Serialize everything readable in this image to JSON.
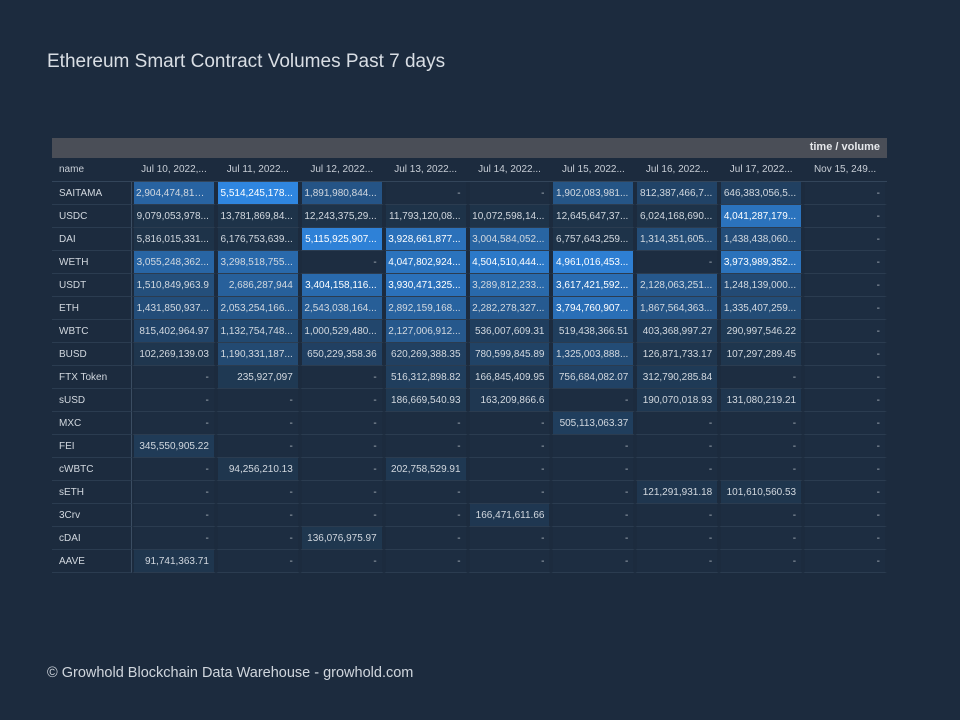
{
  "title": "Ethereum Smart Contract Volumes Past 7 days",
  "footer": "© Growhold Blockchain Data Warehouse - growhold.com",
  "chart_data": {
    "type": "table",
    "title": "Ethereum Smart Contract Volumes Past 7 days",
    "header_label": "time / volume",
    "name_header": "name",
    "columns": [
      "Jul 10, 2022,...",
      "Jul 11, 2022...",
      "Jul 12, 2022...",
      "Jul 13, 2022...",
      "Jul 14, 2022...",
      "Jul 15, 2022...",
      "Jul 16, 2022...",
      "Jul 17, 2022...",
      "Nov 15, 249..."
    ],
    "max_value": 5514245178,
    "rows": [
      {
        "name": "SAITAMA",
        "values": [
          "2,904,474,817,...",
          "5,514,245,178...",
          "1,891,980,844...",
          "-",
          "-",
          "1,902,083,981...",
          "812,387,466,7...",
          "646,383,056,5...",
          "-"
        ],
        "numeric": [
          2904474817,
          5514245178,
          1891980844,
          null,
          null,
          1902083981,
          812387466,
          646383056,
          null
        ]
      },
      {
        "name": "USDC",
        "values": [
          "9,079,053,978...",
          "13,781,869,84...",
          "12,243,375,29...",
          "11,793,120,08...",
          "10,072,598,14...",
          "12,645,647,37...",
          "6,024,168,690...",
          "4,041,287,179...",
          "-"
        ],
        "numeric": [
          9079053978,
          13781869840,
          12243375290,
          11793120080,
          10072598140,
          12645647370,
          6024168690,
          4041287179,
          null
        ]
      },
      {
        "name": "DAI",
        "values": [
          "5,816,015,331...",
          "6,176,753,639...",
          "5,115,925,907...",
          "3,928,661,877...",
          "3,004,584,052...",
          "6,757,643,259...",
          "1,314,351,605...",
          "1,438,438,060...",
          "-"
        ],
        "numeric": [
          5816015331,
          6176753639,
          5115925907,
          3928661877,
          3004584052,
          6757643259,
          1314351605,
          1438438060,
          null
        ]
      },
      {
        "name": "WETH",
        "values": [
          "3,055,248,362...",
          "3,298,518,755...",
          "-",
          "4,047,802,924...",
          "4,504,510,444...",
          "4,961,016,453...",
          "-",
          "3,973,989,352...",
          "-"
        ],
        "numeric": [
          3055248362,
          3298518755,
          null,
          4047802924,
          4504510444,
          4961016453,
          null,
          3973989352,
          null
        ]
      },
      {
        "name": "USDT",
        "values": [
          "1,510,849,963.9",
          "2,686,287,944",
          "3,404,158,116...",
          "3,930,471,325...",
          "3,289,812,233...",
          "3,617,421,592...",
          "2,128,063,251...",
          "1,248,139,000...",
          "-"
        ],
        "numeric": [
          1510849963.9,
          2686287944,
          3404158116,
          3930471325,
          3289812233,
          3617421592,
          2128063251,
          1248139000,
          null
        ]
      },
      {
        "name": "ETH",
        "values": [
          "1,431,850,937...",
          "2,053,254,166...",
          "2,543,038,164...",
          "2,892,159,168...",
          "2,282,278,327...",
          "3,794,760,907...",
          "1,867,564,363...",
          "1,335,407,259...",
          "-"
        ],
        "numeric": [
          1431850937,
          2053254166,
          2543038164,
          2892159168,
          2282278327,
          3794760907,
          1867564363,
          1335407259,
          null
        ]
      },
      {
        "name": "WBTC",
        "values": [
          "815,402,964.97",
          "1,132,754,748...",
          "1,000,529,480...",
          "2,127,006,912...",
          "536,007,609.31",
          "519,438,366.51",
          "403,368,997.27",
          "290,997,546.22",
          "-"
        ],
        "numeric": [
          815402964.97,
          1132754748,
          1000529480,
          2127006912,
          536007609.31,
          519438366.51,
          403368997.27,
          290997546.22,
          null
        ]
      },
      {
        "name": "BUSD",
        "values": [
          "102,269,139.03",
          "1,190,331,187...",
          "650,229,358.36",
          "620,269,388.35",
          "780,599,845.89",
          "1,325,003,888...",
          "126,871,733.17",
          "107,297,289.45",
          "-"
        ],
        "numeric": [
          102269139.03,
          1190331187,
          650229358.36,
          620269388.35,
          780599845.89,
          1325003888,
          126871733.17,
          107297289.45,
          null
        ]
      },
      {
        "name": "FTX Token",
        "values": [
          "-",
          "235,927,097",
          "-",
          "516,312,898.82",
          "166,845,409.95",
          "756,684,082.07",
          "312,790,285.84",
          "-",
          "-"
        ],
        "numeric": [
          null,
          235927097,
          null,
          516312898.82,
          166845409.95,
          756684082.07,
          312790285.84,
          null,
          null
        ]
      },
      {
        "name": "sUSD",
        "values": [
          "-",
          "-",
          "-",
          "186,669,540.93",
          "163,209,866.6",
          "-",
          "190,070,018.93",
          "131,080,219.21",
          "-"
        ],
        "numeric": [
          null,
          null,
          null,
          186669540.93,
          163209866.6,
          null,
          190070018.93,
          131080219.21,
          null
        ]
      },
      {
        "name": "MXC",
        "values": [
          "-",
          "-",
          "-",
          "-",
          "-",
          "505,113,063.37",
          "-",
          "-",
          "-"
        ],
        "numeric": [
          null,
          null,
          null,
          null,
          null,
          505113063.37,
          null,
          null,
          null
        ]
      },
      {
        "name": "FEI",
        "values": [
          "345,550,905.22",
          "-",
          "-",
          "-",
          "-",
          "-",
          "-",
          "-",
          "-"
        ],
        "numeric": [
          345550905.22,
          null,
          null,
          null,
          null,
          null,
          null,
          null,
          null
        ]
      },
      {
        "name": "cWBTC",
        "values": [
          "-",
          "94,256,210.13",
          "-",
          "202,758,529.91",
          "-",
          "-",
          "-",
          "-",
          "-"
        ],
        "numeric": [
          null,
          94256210.13,
          null,
          202758529.91,
          null,
          null,
          null,
          null,
          null
        ]
      },
      {
        "name": "sETH",
        "values": [
          "-",
          "-",
          "-",
          "-",
          "-",
          "-",
          "121,291,931.18",
          "101,610,560.53",
          "-"
        ],
        "numeric": [
          null,
          null,
          null,
          null,
          null,
          null,
          121291931.18,
          101610560.53,
          null
        ]
      },
      {
        "name": "3Crv",
        "values": [
          "-",
          "-",
          "-",
          "-",
          "166,471,611.66",
          "-",
          "-",
          "-",
          "-"
        ],
        "numeric": [
          null,
          null,
          null,
          null,
          166471611.66,
          null,
          null,
          null,
          null
        ]
      },
      {
        "name": "cDAI",
        "values": [
          "-",
          "-",
          "136,076,975.97",
          "-",
          "-",
          "-",
          "-",
          "-",
          "-"
        ],
        "numeric": [
          null,
          null,
          136076975.97,
          null,
          null,
          null,
          null,
          null,
          null
        ]
      },
      {
        "name": "AAVE",
        "values": [
          "91,741,363.71",
          "-",
          "-",
          "-",
          "-",
          "-",
          "-",
          "-",
          "-"
        ],
        "numeric": [
          91741363.71,
          null,
          null,
          null,
          null,
          null,
          null,
          null,
          null
        ]
      }
    ]
  },
  "colors": {
    "background": "#1c2b3e",
    "header_band": "#4a4e57",
    "cell_min": "#1e3349",
    "cell_max": "#2f86e0"
  }
}
